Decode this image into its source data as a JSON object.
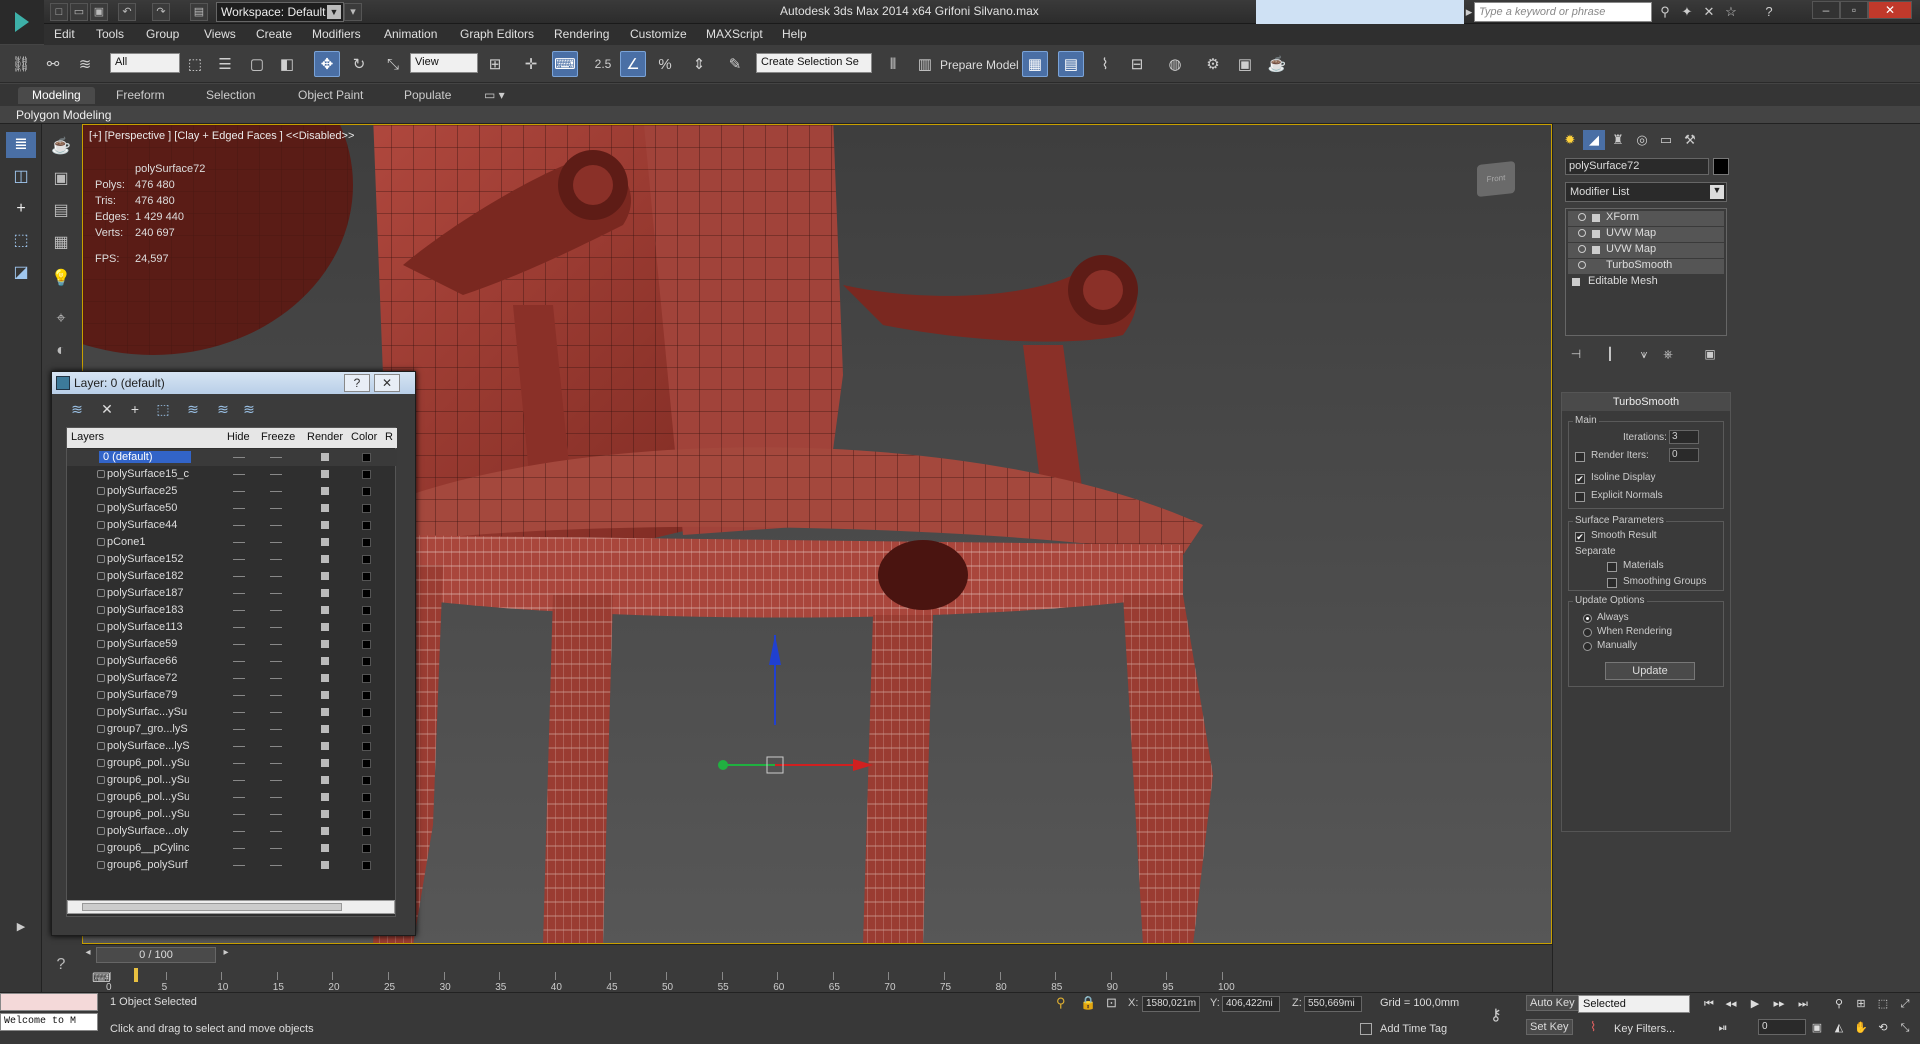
{
  "window": {
    "title": "Autodesk 3ds Max  2014 x64    Grifoni Silvano.max",
    "workspace": "Workspace: Default",
    "search_placeholder": "Type a keyword or phrase"
  },
  "menus": [
    "Edit",
    "Tools",
    "Group",
    "Views",
    "Create",
    "Modifiers",
    "Animation",
    "Graph Editors",
    "Rendering",
    "Customize",
    "MAXScript",
    "Help"
  ],
  "toolbar": {
    "filter": "All",
    "ref_coord": "View",
    "spinner_value": "2.5",
    "selection_set": "Create Selection Se",
    "prepare_model": "Prepare Model"
  },
  "ribbon": {
    "tabs": [
      "Modeling",
      "Freeform",
      "Selection",
      "Object Paint",
      "Populate"
    ],
    "active_tab": "Modeling",
    "panel": "Polygon Modeling"
  },
  "viewport": {
    "label": "[+] [Perspective ] [Clay + Edged Faces ]  <<Disabled>>",
    "object": "polySurface72",
    "stats": [
      {
        "k": "Polys:",
        "v": "476 480"
      },
      {
        "k": "Tris:",
        "v": "476 480"
      },
      {
        "k": "Edges:",
        "v": "1 429 440"
      },
      {
        "k": "Verts:",
        "v": "240 697"
      }
    ],
    "fps_label": "FPS:",
    "fps": "24,597",
    "viewcube_label": "Front"
  },
  "layer_dialog": {
    "title": "Layer: 0 (default)",
    "columns": [
      "Layers",
      "Hide",
      "Freeze",
      "Render",
      "Color",
      "R"
    ],
    "selected": "0 (default)",
    "layers": [
      "polySurface15_c",
      "polySurface25",
      "polySurface50",
      "polySurface44",
      "pCone1",
      "polySurface152",
      "polySurface182",
      "polySurface187",
      "polySurface183",
      "polySurface113",
      "polySurface59",
      "polySurface66",
      "polySurface72",
      "polySurface79",
      "polySurfac...ySu",
      "group7_gro...lyS",
      "polySurface...lyS",
      "group6_pol...ySu",
      "group6_pol...ySu",
      "group6_pol...ySu",
      "group6_pol...ySu",
      "polySurface...oly",
      "group6__pCylinc",
      "group6_polySurf"
    ]
  },
  "command_panel": {
    "object_name": "polySurface72",
    "modifier_list": "Modifier List",
    "stack": [
      "XForm",
      "UVW Map",
      "UVW Map",
      "TurboSmooth"
    ],
    "base": "Editable Mesh",
    "turbosmooth": {
      "title": "TurboSmooth",
      "main": "Main",
      "iterations_label": "Iterations:",
      "iterations": "3",
      "render_iters_label": "Render Iters:",
      "render_iters": "0",
      "isoline": "Isoline Display",
      "explicit": "Explicit Normals",
      "surface": "Surface Parameters",
      "smooth_result": "Smooth Result",
      "separate": "Separate",
      "materials": "Materials",
      "smoothing": "Smoothing Groups",
      "update_options": "Update Options",
      "always": "Always",
      "when_rendering": "When Rendering",
      "manually": "Manually",
      "update": "Update"
    }
  },
  "timeline": {
    "slider": "0 / 100",
    "ticks": [
      "0",
      "5",
      "10",
      "15",
      "20",
      "25",
      "30",
      "35",
      "40",
      "45",
      "50",
      "55",
      "60",
      "65",
      "70",
      "75",
      "80",
      "85",
      "90",
      "95",
      "100"
    ]
  },
  "status": {
    "maxscript": "Welcome to M",
    "selected": "1 Object Selected",
    "prompt": "Click and drag to select and move objects",
    "x_label": "X:",
    "x": "1580,021m",
    "y_label": "Y:",
    "y": "406,422mi",
    "z_label": "Z:",
    "z": "550,669mi",
    "grid": "Grid = 100,0mm",
    "add_time_tag": "Add Time Tag",
    "auto_key": "Auto Key",
    "set_key": "Set Key",
    "key_mode": "Selected",
    "key_filters": "Key Filters...",
    "frame": "0"
  }
}
